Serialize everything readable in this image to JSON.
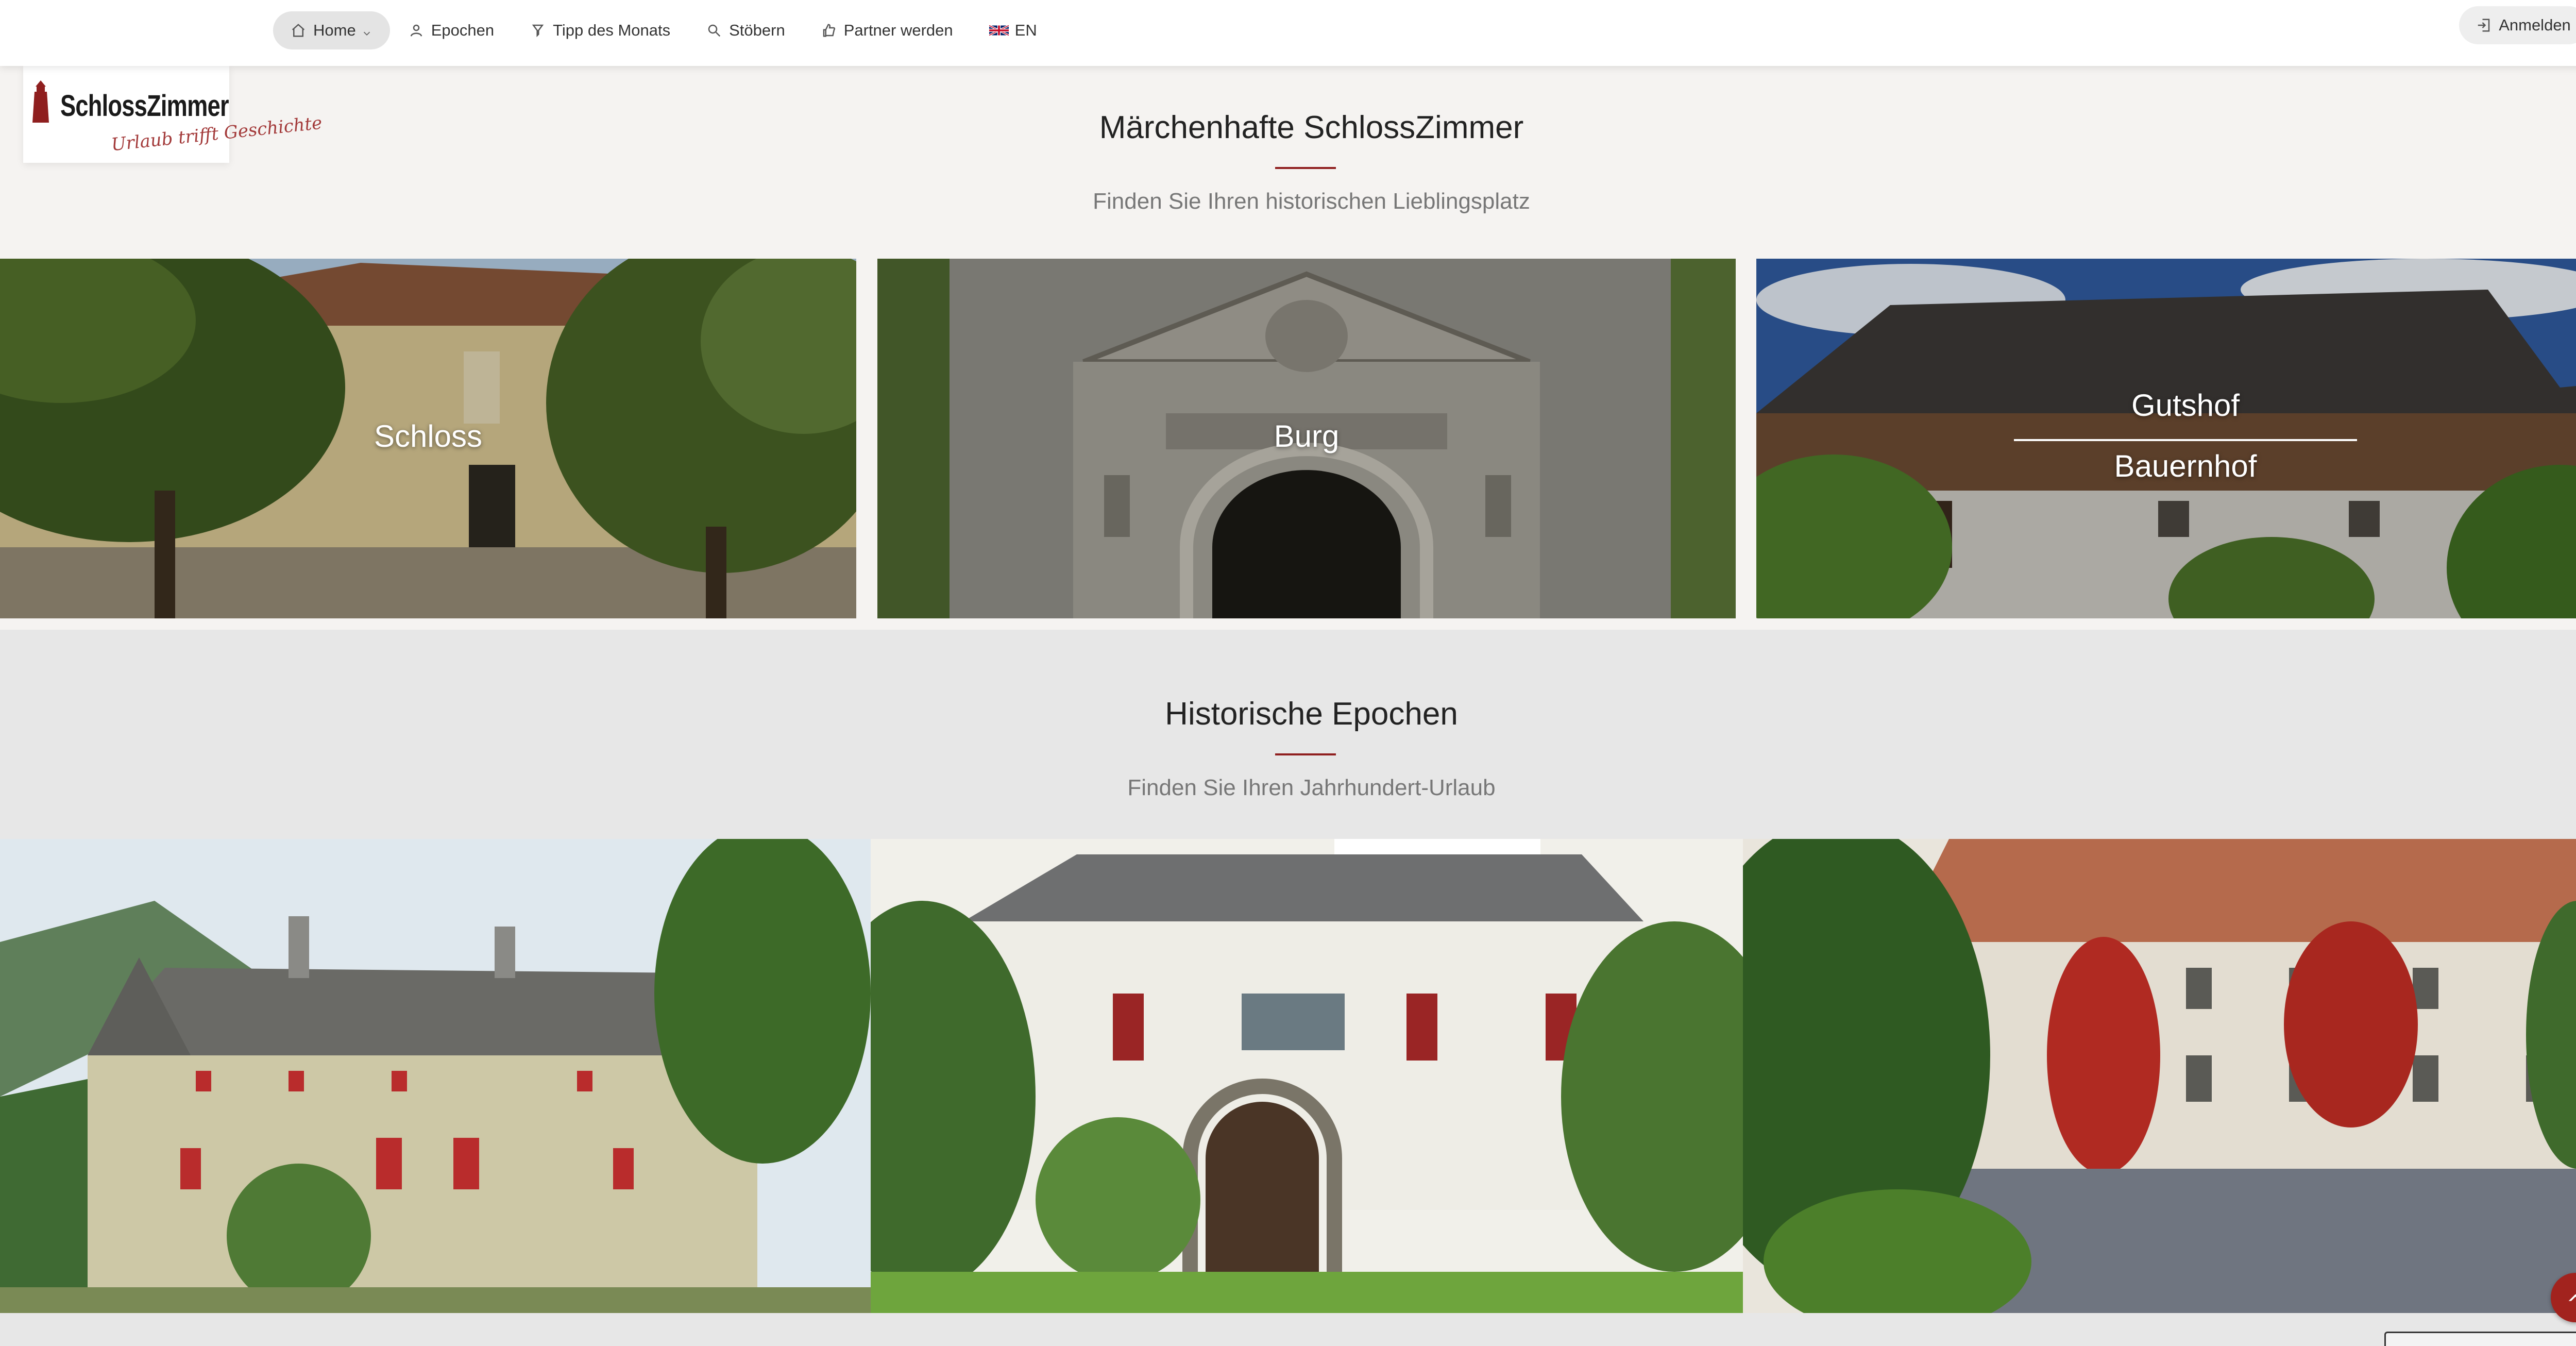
{
  "nav": {
    "items": [
      {
        "label": "Home",
        "icon": "home-icon",
        "active": true
      },
      {
        "label": "Epochen",
        "icon": "epochs-icon"
      },
      {
        "label": "Tipp des Monats",
        "icon": "tip-icon"
      },
      {
        "label": "Stöbern",
        "icon": "search-icon"
      },
      {
        "label": "Partner werden",
        "icon": "thumbs-up-icon"
      },
      {
        "label": "EN",
        "icon": "uk-flag-icon"
      }
    ],
    "login_label": "Anmelden"
  },
  "logo": {
    "wordmark": "SchlossZimmer",
    "tagline": "Urlaub trifft Geschichte"
  },
  "section1": {
    "title": "Märchenhafte SchlossZimmer",
    "subtitle": "Finden Sie Ihren historischen Lieblingsplatz"
  },
  "categories": [
    {
      "label": "Schloss"
    },
    {
      "label": "Burg"
    },
    {
      "label_top": "Gutshof",
      "label_bottom": "Bauernhof"
    }
  ],
  "section2": {
    "title": "Historische Epochen",
    "subtitle": "Finden Sie Ihren Jahrhundert-Urlaub"
  },
  "colors": {
    "accent": "#8f1f1f",
    "back_to_top": "#a2231e",
    "nav_active_bg": "#e4e4e4"
  }
}
